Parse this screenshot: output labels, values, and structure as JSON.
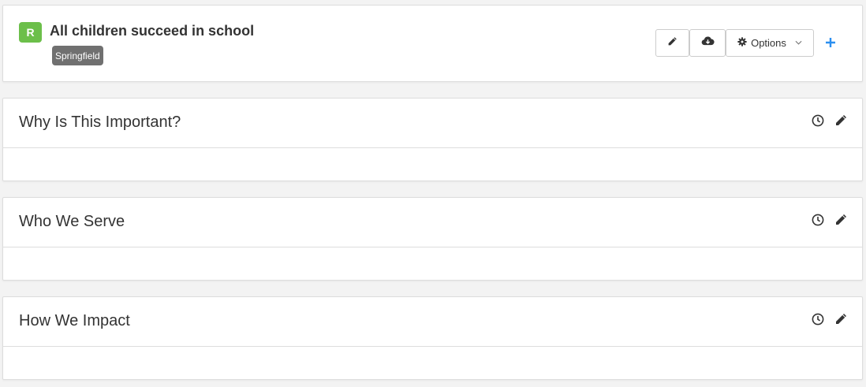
{
  "header": {
    "badge_letter": "R",
    "badge_color": "#6cbf4a",
    "title": "All children succeed in school",
    "tag": "Springfield",
    "toolbar": {
      "edit_icon": "pencil-icon",
      "download_icon": "cloud-download-icon",
      "options_label": "Options",
      "options_icon": "gear-icon",
      "add_icon": "plus-icon",
      "add_color": "#2b8ff0"
    }
  },
  "sections": [
    {
      "title": "Why Is This Important?",
      "history_icon": "clock-icon",
      "edit_icon": "pencil-icon"
    },
    {
      "title": "Who We Serve",
      "history_icon": "clock-icon",
      "edit_icon": "pencil-icon"
    },
    {
      "title": "How We Impact",
      "history_icon": "clock-icon",
      "edit_icon": "pencil-icon"
    }
  ]
}
